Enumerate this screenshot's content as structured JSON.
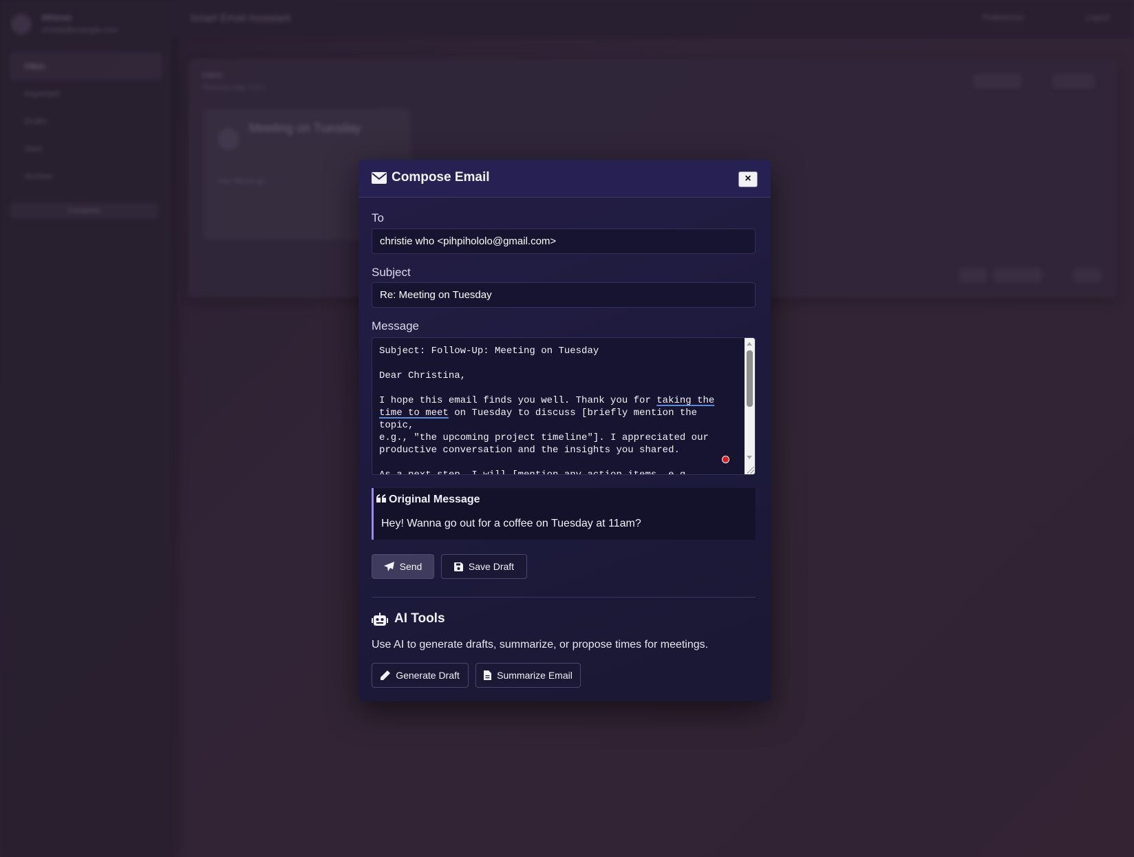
{
  "background": {
    "user_name": "Whtmer",
    "user_email": "christie@example.com",
    "nav_items": [
      "Inbox",
      "Important",
      "Drafts",
      "Sent",
      "Archive"
    ],
    "sidebar_button": "Compose",
    "app_title": "Smart Email Assistant",
    "header_links": [
      "Preferences",
      "Logout"
    ],
    "panel_title": "Inbox",
    "panel_subtitle": "Showing page 1 of 1",
    "card_title": "Meeting on Tuesday",
    "card_snippet": "Hey! Wanna go..."
  },
  "modal": {
    "title": "Compose Email",
    "close_label": "×",
    "to_label": "To",
    "to_value": "christie who <pihpihololo@gmail.com>",
    "subject_label": "Subject",
    "subject_value": "Re: Meeting on Tuesday",
    "message_label": "Message",
    "message": {
      "line_subject": "Subject: Follow-Up: Meeting on Tuesday",
      "greeting": "Dear Christina,",
      "p1_a": "I hope this email finds you well. Thank you for ",
      "p1_b": "taking the",
      "p1_c": "time to meet",
      "p1_d": " on Tuesday to discuss [briefly mention the topic,\ne.g., \"the upcoming project timeline\"]. I appreciated our\nproductive conversation and the insights you shared.",
      "p2": "As a next step, I will [mention any action items, e.g.,\n\"compile the notes and share them with the team by Friday\"]."
    },
    "original_title": "Original Message",
    "original_body": "Hey! Wanna go out for a coffee on Tuesday at 11am?",
    "send_label": "Send",
    "save_draft_label": "Save Draft",
    "ai_title": "AI Tools",
    "ai_description": "Use AI to generate drafts, summarize, or propose times for meetings.",
    "generate_label": "Generate Draft",
    "summarize_label": "Summarize Email"
  },
  "colors": {
    "modal_bg": "#1d1a3c",
    "header_bg": "#272052",
    "accent": "#9d87e8",
    "input_bg": "#161431"
  },
  "icons": [
    "envelope-icon",
    "close-icon",
    "quote-icon",
    "send-icon",
    "save-icon",
    "robot-icon",
    "pencil-icon",
    "document-icon"
  ]
}
